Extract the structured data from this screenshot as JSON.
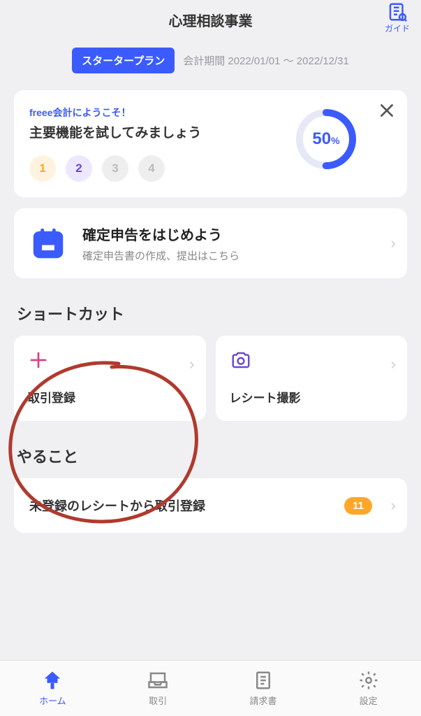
{
  "header": {
    "title": "心理相談事業",
    "guide_label": "ガイド"
  },
  "plan": {
    "badge": "スタータープラン",
    "period": "会計期間 2022/01/01 〜 2022/12/31"
  },
  "welcome": {
    "sub": "freee会計にようこそ！",
    "title": "主要機能を試してみましょう",
    "steps": [
      "1",
      "2",
      "3",
      "4"
    ],
    "progress_value": "50",
    "progress_unit": "%"
  },
  "tax": {
    "title": "確定申告をはじめよう",
    "sub": "確定申告書の作成、提出はこちら"
  },
  "sections": {
    "shortcuts": "ショートカット",
    "todo": "やること"
  },
  "shortcuts": [
    {
      "label": "取引登録"
    },
    {
      "label": "レシート撮影"
    }
  ],
  "todo": [
    {
      "label": "未登録のレシートから取引登録",
      "count": "11"
    }
  ],
  "tabs": [
    {
      "label": "ホーム"
    },
    {
      "label": "取引"
    },
    {
      "label": "請求書"
    },
    {
      "label": "設定"
    }
  ]
}
